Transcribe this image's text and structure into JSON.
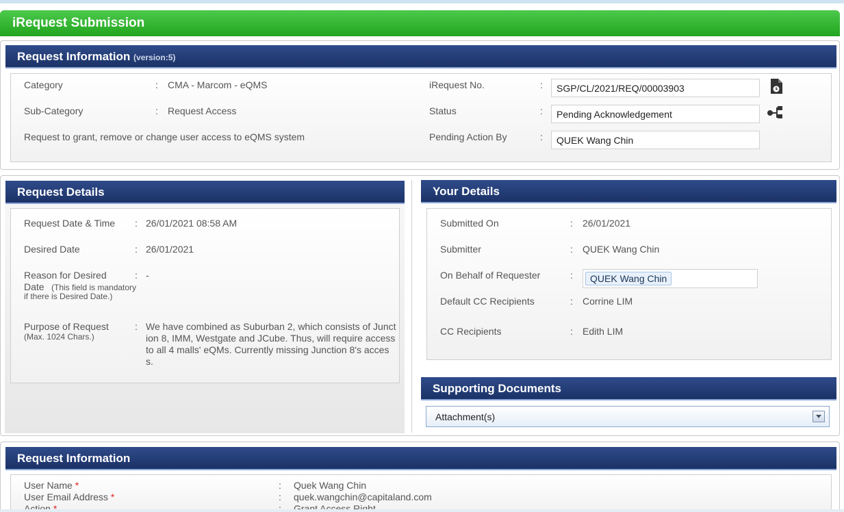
{
  "page": {
    "title": "iRequest Submission"
  },
  "request_info": {
    "heading": "Request Information",
    "version": "(version:5)",
    "category_label": "Category",
    "category_value": "CMA - Marcom - eQMS",
    "subcategory_label": "Sub-Category",
    "subcategory_value": "Request Access",
    "description": "Request to grant, remove or change user access to eQMS system",
    "no_label": "iRequest No.",
    "no_value": "SGP/CL/2021/REQ/00003903",
    "status_label": "Status",
    "status_value": "Pending Acknowledgement",
    "pending_label": "Pending Action By",
    "pending_value": "QUEK Wang Chin",
    "sep": ":"
  },
  "request_details": {
    "heading": "Request Details",
    "date_label": "Request Date & Time",
    "date_value": "26/01/2021 08:58 AM",
    "desired_label": "Desired Date",
    "desired_value": "26/01/2021",
    "reason_label": "Reason for Desired",
    "reason_label_2": "Date",
    "reason_note": "(This field is mandatory if there is Desired Date.)",
    "reason_value": "-",
    "purpose_label": "Purpose of Request",
    "purpose_note": "(Max. 1024 Chars.)",
    "purpose_value": "We have combined as Suburban 2, which consists of Junction 8, IMM, Westgate and JCube. Thus, will require access to all 4 malls' eQMs. Currently missing Junction 8's access."
  },
  "your_details": {
    "heading": "Your Details",
    "submitted_label": "Submitted On",
    "submitted_value": "26/01/2021",
    "submitter_label": "Submitter",
    "submitter_value": "QUEK Wang Chin",
    "behalf_label": "On Behalf of Requester",
    "behalf_value": "QUEK Wang Chin",
    "cc_default_label": "Default CC Recipients",
    "cc_default_value": "Corrine LIM",
    "cc_label": "CC Recipients",
    "cc_value": "Edith LIM"
  },
  "supporting_docs": {
    "heading": "Supporting Documents",
    "attachment_label": "Attachment(s)"
  },
  "request_info_2": {
    "heading": "Request Information",
    "user_name_label": "User Name",
    "user_name_value": "Quek Wang Chin",
    "email_label": "User Email Address",
    "email_value": "quek.wangchin@capitaland.com",
    "action_label": "Action",
    "action_value": "Grant Access Right",
    "required_mark": "*"
  },
  "icons": {
    "history": "document-history-icon",
    "workflow": "workflow-icon",
    "dropdown": "chevron-down-icon"
  },
  "colors": {
    "title_bar": "#22a51e",
    "panel_header": "#1b3266",
    "required": "#e02020"
  }
}
